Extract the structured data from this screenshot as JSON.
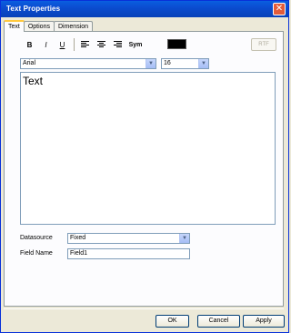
{
  "window": {
    "title": "Text Properties"
  },
  "tabs": [
    {
      "label": "Text",
      "active": true
    },
    {
      "label": "Options",
      "active": false
    },
    {
      "label": "Dimension",
      "active": false
    }
  ],
  "toolbar": {
    "bold": "B",
    "italic": "I",
    "underline": "U",
    "sym": "Sym",
    "rtf": "RTF",
    "text_color": "#000000"
  },
  "font": {
    "family": "Arial",
    "size": "16"
  },
  "editor": {
    "content": "Text"
  },
  "datasource": {
    "label": "Datasource",
    "value": "Fixed"
  },
  "field_name": {
    "label": "Field Name",
    "value": "Field1"
  },
  "buttons": {
    "ok": "OK",
    "cancel": "Cancel",
    "apply": "Apply"
  }
}
